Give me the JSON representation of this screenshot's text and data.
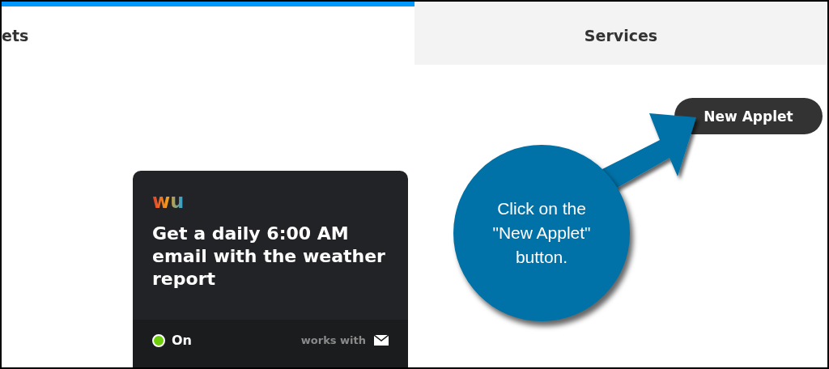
{
  "tabs": [
    {
      "label": "ets",
      "selected": true
    },
    {
      "label": "Services",
      "selected": false
    }
  ],
  "new_applet_button": "New Applet",
  "applet_card": {
    "logo": "wu",
    "title": "Get a daily 6:00 AM email with the weather report",
    "status": {
      "label": "On",
      "on": true
    },
    "works_with": "works with"
  },
  "callout": {
    "text": "Click on the \"New Applet\" button."
  }
}
